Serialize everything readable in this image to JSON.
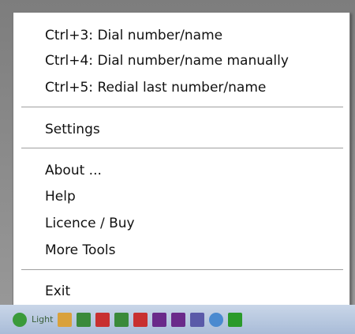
{
  "menu": {
    "items": [
      {
        "label": "Ctrl+3: Dial number/name"
      },
      {
        "label": "Ctrl+4: Dial number/name manually"
      },
      {
        "label": "Ctrl+5: Redial last number/name"
      },
      {
        "label": "Settings"
      },
      {
        "label": "About ..."
      },
      {
        "label": "Help"
      },
      {
        "label": "Licence / Buy"
      },
      {
        "label": "More Tools"
      },
      {
        "label": "Exit"
      }
    ]
  },
  "tray": {
    "text": "Light",
    "icons": [
      {
        "name": "app-icon",
        "color": "#3a9a3a"
      },
      {
        "name": "pen-icon",
        "color": "#d9a13c"
      },
      {
        "name": "tile-icon",
        "color": "#3a8a3a"
      },
      {
        "name": "tile-icon",
        "color": "#c83030"
      },
      {
        "name": "tile-icon",
        "color": "#3a8a3a"
      },
      {
        "name": "tile-icon",
        "color": "#c83030"
      },
      {
        "name": "tile-icon",
        "color": "#6a2a8a"
      },
      {
        "name": "tile-icon",
        "color": "#6a2a8a"
      },
      {
        "name": "tile-icon",
        "color": "#5a5aa8"
      },
      {
        "name": "shield-icon",
        "color": "#4a8ad0"
      },
      {
        "name": "check-icon",
        "color": "#2a9a2a"
      }
    ]
  }
}
